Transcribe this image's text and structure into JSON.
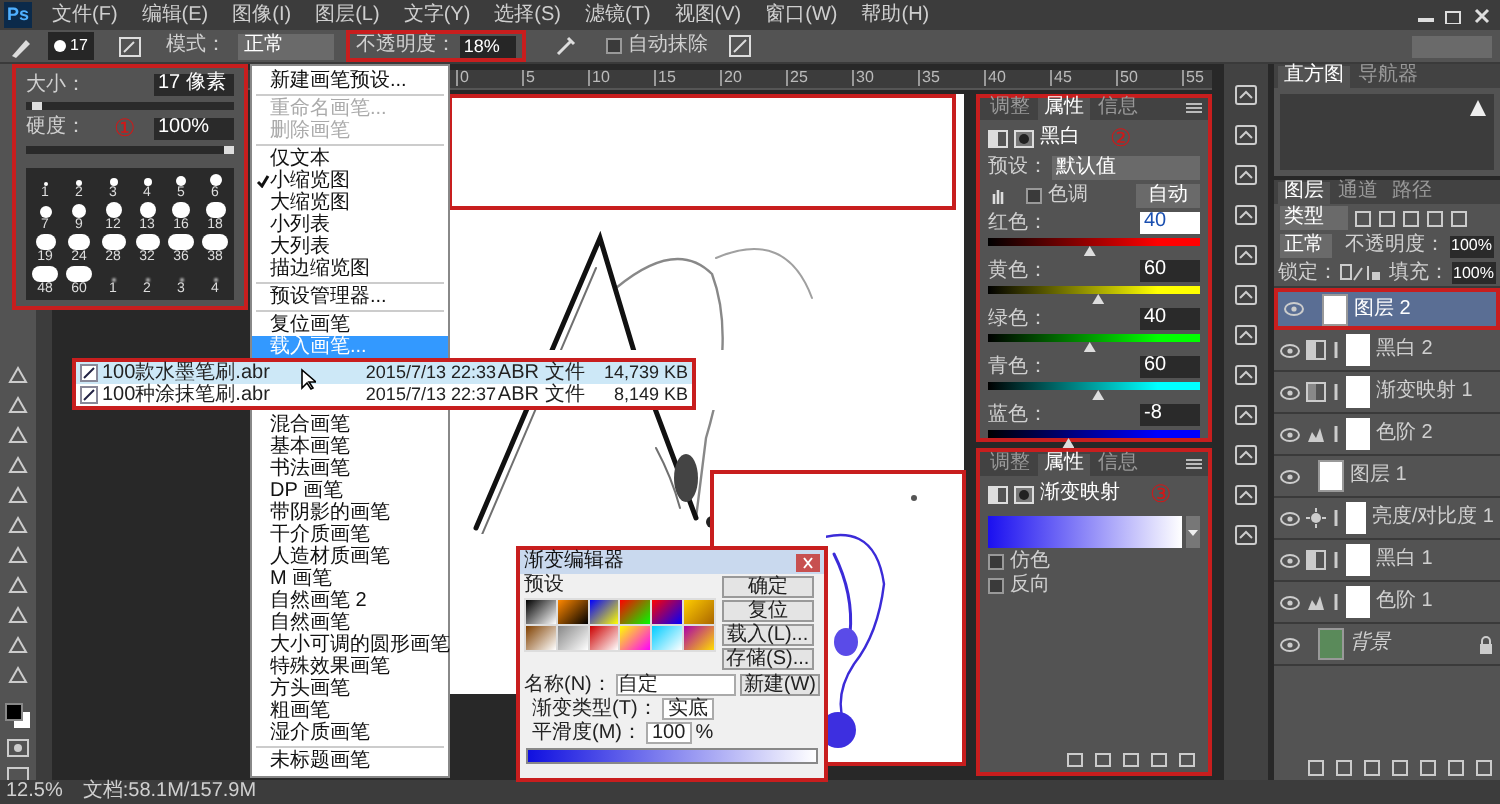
{
  "menu_bar": {
    "logo": "Ps",
    "items": [
      "文件(F)",
      "编辑(E)",
      "图像(I)",
      "图层(L)",
      "文字(Y)",
      "选择(S)",
      "滤镜(T)",
      "视图(V)",
      "窗口(W)",
      "帮助(H)"
    ]
  },
  "options_bar": {
    "brush_size": "17",
    "mode_label": "模式：",
    "mode": "正常",
    "opacity_label": "不透明度：",
    "opacity": "18%",
    "auto_erase": {
      "label": "自动抹除",
      "checked": false
    }
  },
  "brush_panel": {
    "marker": "①",
    "size_label": "大小：",
    "size": "17 像素",
    "size_slider": {
      "level": 0.05
    },
    "hardness_label": "硬度：",
    "hardness": "100%",
    "hardness_slider": {
      "level": 1
    },
    "presets": [
      {
        "label": "1",
        "kind": "hard"
      },
      {
        "label": "2",
        "kind": "hard"
      },
      {
        "label": "3",
        "kind": "hard"
      },
      {
        "label": "4",
        "kind": "hard"
      },
      {
        "label": "5",
        "kind": "hard"
      },
      {
        "label": "6",
        "kind": "hard"
      },
      {
        "label": "7",
        "kind": "hard"
      },
      {
        "label": "9",
        "kind": "hard"
      },
      {
        "label": "12",
        "kind": "hard"
      },
      {
        "label": "13",
        "kind": "hard"
      },
      {
        "label": "16",
        "kind": "hard"
      },
      {
        "label": "18",
        "kind": "hard"
      },
      {
        "label": "19",
        "kind": "hard"
      },
      {
        "label": "24",
        "kind": "hard"
      },
      {
        "label": "28",
        "kind": "hard"
      },
      {
        "label": "32",
        "kind": "hard"
      },
      {
        "label": "36",
        "kind": "hard"
      },
      {
        "label": "38",
        "kind": "hard"
      },
      {
        "label": "48",
        "kind": "hard"
      },
      {
        "label": "60",
        "kind": "hard"
      },
      {
        "label": "1",
        "kind": "soft"
      },
      {
        "label": "2",
        "kind": "soft"
      },
      {
        "label": "3",
        "kind": "soft"
      },
      {
        "label": "4",
        "kind": "soft"
      }
    ]
  },
  "brush_menu": {
    "items": [
      {
        "kind": "item",
        "label": "新建画笔预设...",
        "disabled": false,
        "checked": false,
        "selected": false
      },
      {
        "kind": "divider"
      },
      {
        "kind": "item",
        "label": "重命名画笔...",
        "disabled": true,
        "checked": false,
        "selected": false
      },
      {
        "kind": "item",
        "label": "删除画笔",
        "disabled": true,
        "checked": false,
        "selected": false
      },
      {
        "kind": "divider"
      },
      {
        "kind": "item",
        "label": "仅文本",
        "disabled": false,
        "checked": false,
        "selected": false
      },
      {
        "kind": "item",
        "label": "小缩览图",
        "disabled": false,
        "checked": true,
        "selected": false
      },
      {
        "kind": "item",
        "label": "大缩览图",
        "disabled": false,
        "checked": false,
        "selected": false
      },
      {
        "kind": "item",
        "label": "小列表",
        "disabled": false,
        "checked": false,
        "selected": false
      },
      {
        "kind": "item",
        "label": "大列表",
        "disabled": false,
        "checked": false,
        "selected": false
      },
      {
        "kind": "item",
        "label": "描边缩览图",
        "disabled": false,
        "checked": false,
        "selected": false
      },
      {
        "kind": "divider"
      },
      {
        "kind": "item",
        "label": "预设管理器...",
        "disabled": false,
        "checked": false,
        "selected": false
      },
      {
        "kind": "divider"
      },
      {
        "kind": "item",
        "label": "复位画笔",
        "disabled": false,
        "checked": false,
        "selected": false
      },
      {
        "kind": "item",
        "label": "载入画笔...",
        "disabled": false,
        "checked": false,
        "selected": true
      }
    ],
    "library_items": [
      {
        "kind": "item",
        "label": "混合画笔"
      },
      {
        "kind": "item",
        "label": "基本画笔"
      },
      {
        "kind": "item",
        "label": "书法画笔"
      },
      {
        "kind": "item",
        "label": "DP 画笔"
      },
      {
        "kind": "item",
        "label": "带阴影的画笔"
      },
      {
        "kind": "item",
        "label": "干介质画笔"
      },
      {
        "kind": "item",
        "label": "人造材质画笔"
      },
      {
        "kind": "item",
        "label": "M 画笔"
      },
      {
        "kind": "item",
        "label": "自然画笔 2"
      },
      {
        "kind": "item",
        "label": "自然画笔"
      },
      {
        "kind": "item",
        "label": "大小可调的圆形画笔"
      },
      {
        "kind": "item",
        "label": "特殊效果画笔"
      },
      {
        "kind": "item",
        "label": "方头画笔"
      },
      {
        "kind": "item",
        "label": "粗画笔"
      },
      {
        "kind": "item",
        "label": "湿介质画笔"
      },
      {
        "kind": "divider"
      },
      {
        "kind": "item",
        "label": "未标题画笔"
      }
    ]
  },
  "file_list": {
    "rows": [
      {
        "name": "100款水墨笔刷.abr",
        "date": "2015/7/13 22:33",
        "type": "ABR 文件",
        "size": "14,739 KB",
        "selected": true
      },
      {
        "name": "100种涂抹笔刷.abr",
        "date": "2015/7/13 22:37",
        "type": "ABR 文件",
        "size": "8,149 KB",
        "selected": false
      }
    ]
  },
  "ruler": {
    "labels": [
      "0",
      "5",
      "10",
      "15",
      "20",
      "25",
      "30",
      "35",
      "40",
      "45",
      "50",
      "55"
    ]
  },
  "adjustment_panels": [
    {
      "kind": "black-white",
      "marker": "②",
      "tabs": [
        {
          "label": "调整",
          "selected": false
        },
        {
          "label": "属性",
          "selected": true
        },
        {
          "label": "信息",
          "selected": false
        }
      ],
      "title": "黑白",
      "preset_label": "预设：",
      "preset": "默认值",
      "tint": {
        "label": "色调",
        "checked": false
      },
      "auto_button": "自动",
      "sliders": [
        {
          "label": "红色：",
          "value": "40",
          "level": 0.48,
          "color": "#ff0000"
        },
        {
          "label": "黄色：",
          "value": "60",
          "level": 0.52,
          "color": "#ffff00"
        },
        {
          "label": "绿色：",
          "value": "40",
          "level": 0.48,
          "color": "#00ff00"
        },
        {
          "label": "青色：",
          "value": "60",
          "level": 0.52,
          "color": "#00ffff"
        },
        {
          "label": "蓝色：",
          "value": "-8",
          "level": 0.38,
          "color": "#0000ff"
        }
      ]
    },
    {
      "kind": "gradient-map",
      "marker": "③",
      "tabs": [
        {
          "label": "调整",
          "selected": false
        },
        {
          "label": "属性",
          "selected": true
        },
        {
          "label": "信息",
          "selected": false
        }
      ],
      "title": "渐变映射",
      "options": [
        {
          "label": "仿色",
          "checked": false
        },
        {
          "label": "反向",
          "checked": false
        }
      ]
    }
  ],
  "histogram_panel": {
    "tabs": [
      {
        "label": "直方图",
        "selected": true
      },
      {
        "label": "导航器",
        "selected": false
      }
    ]
  },
  "layers_panel": {
    "tabs": [
      {
        "label": "图层",
        "selected": true
      },
      {
        "label": "通道",
        "selected": false
      },
      {
        "label": "路径",
        "selected": false
      }
    ],
    "filter": "类型",
    "blend_mode": "正常",
    "opacity_label": "不透明度：",
    "opacity": "100%",
    "lock_label": "锁定：",
    "fill_label": "填充：",
    "fill": "100%",
    "layers": [
      {
        "name": "图层 2",
        "kind": "pixel",
        "selected": true
      },
      {
        "name": "黑白 2",
        "kind": "black-white",
        "selected": false
      },
      {
        "name": "渐变映射 1",
        "kind": "gradient-map",
        "selected": false
      },
      {
        "name": "色阶 2",
        "kind": "levels",
        "selected": false
      },
      {
        "name": "图层 1",
        "kind": "pixel",
        "selected": false
      },
      {
        "name": "亮度/对比度 1",
        "kind": "brightness",
        "selected": false
      },
      {
        "name": "黑白 1",
        "kind": "black-white",
        "selected": false
      },
      {
        "name": "色阶 1",
        "kind": "levels",
        "selected": false
      },
      {
        "name": "背景",
        "kind": "background",
        "selected": false
      }
    ]
  },
  "gradient_editor": {
    "title": "渐变编辑器",
    "presets_label": "预设",
    "buttons": [
      "确定",
      "复位",
      "载入(L)...",
      "存储(S)..."
    ],
    "name_label": "名称(N)：",
    "name": "自定",
    "new_button": "新建(W)",
    "type_label": "渐变类型(T)：",
    "type": "实底",
    "smoothness_label": "平滑度(M)：",
    "smoothness": "100",
    "percent": "%"
  },
  "status_bar": {
    "zoom": "12.5%",
    "doc_info": "文档:58.1M/157.9M"
  }
}
